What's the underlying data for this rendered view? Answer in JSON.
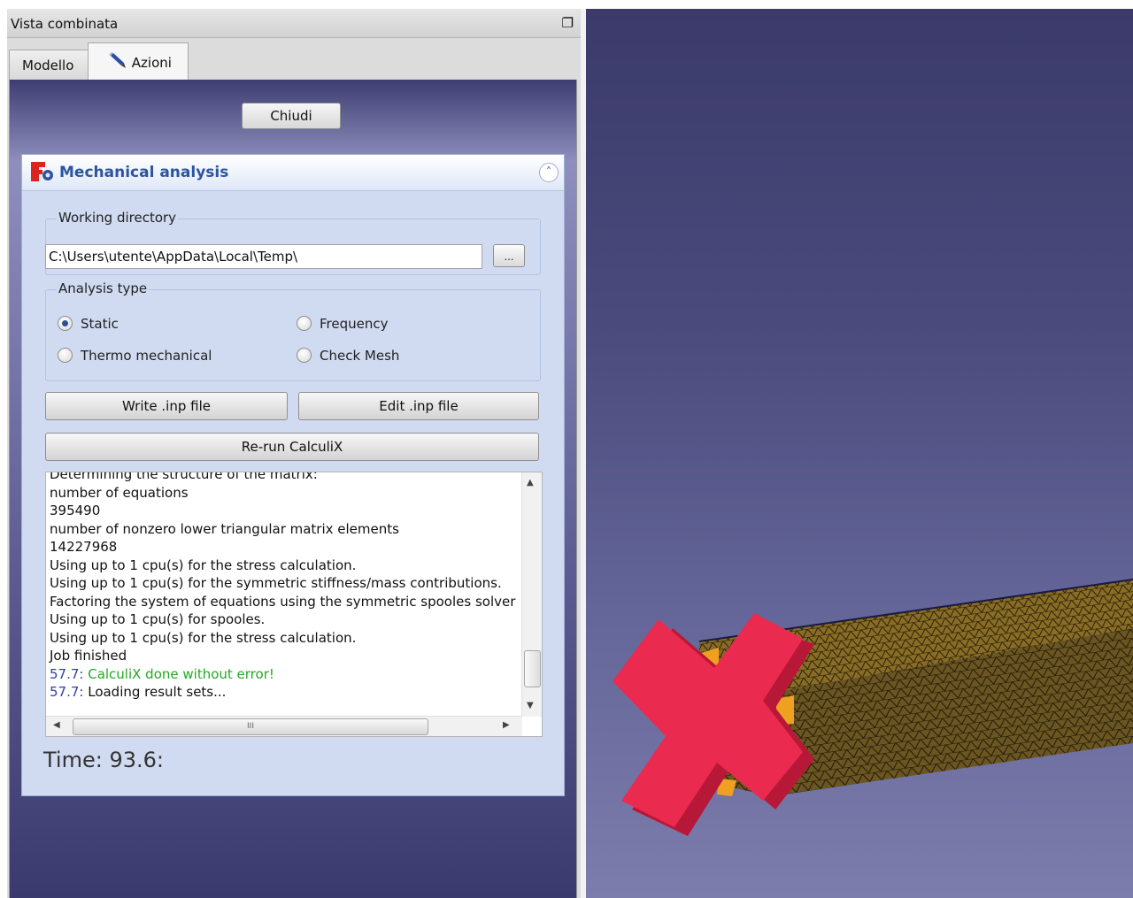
{
  "dock": {
    "title": "Vista combinata",
    "tabs": [
      {
        "label": "Modello",
        "icon": "none",
        "active": false
      },
      {
        "label": "Azioni",
        "icon": "pencil-icon",
        "active": true
      }
    ],
    "close_label": "Chiudi"
  },
  "panel": {
    "title": "Mechanical analysis",
    "icon": "freecad-fem-icon",
    "working_directory": {
      "legend": "Working directory",
      "value": "C:\\Users\\utente\\AppData\\Local\\Temp\\",
      "browse_label": "..."
    },
    "analysis_type": {
      "legend": "Analysis type",
      "options": [
        {
          "label": "Static",
          "checked": true
        },
        {
          "label": "Frequency",
          "checked": false
        },
        {
          "label": "Thermo mechanical",
          "checked": false
        },
        {
          "label": "Check Mesh",
          "checked": false
        }
      ]
    },
    "buttons": {
      "write_inp": "Write .inp file",
      "edit_inp": "Edit .inp file",
      "rerun": "Re-run CalculiX"
    },
    "log": {
      "cut_line": "Determining the structure of the matrix:",
      "lines": [
        "number of equations",
        "395490",
        "number of nonzero lower triangular matrix elements",
        "14227968",
        "Using up to 1 cpu(s) for the stress calculation.",
        "Using up to 1 cpu(s) for the symmetric stiffness/mass contributions.",
        "Factoring the system of equations using the symmetric spooles solver",
        "Using up to 1 cpu(s) for spooles.",
        "Using up to 1 cpu(s) for the stress calculation.",
        "Job finished"
      ],
      "done_ts": "57.7:",
      "done_msg": " CalculiX done without error!",
      "loading_ts": "57.7:",
      "loading_msg": " Loading result sets...",
      "hscroll_grip": "III"
    },
    "time_label": "Time: 93.6:"
  },
  "colors": {
    "panel_title": "#2c55a0",
    "success": "#23a823",
    "timestamp": "#2b3fa8",
    "marker_cross": "#e8264a",
    "mesh": "#6b5520"
  }
}
